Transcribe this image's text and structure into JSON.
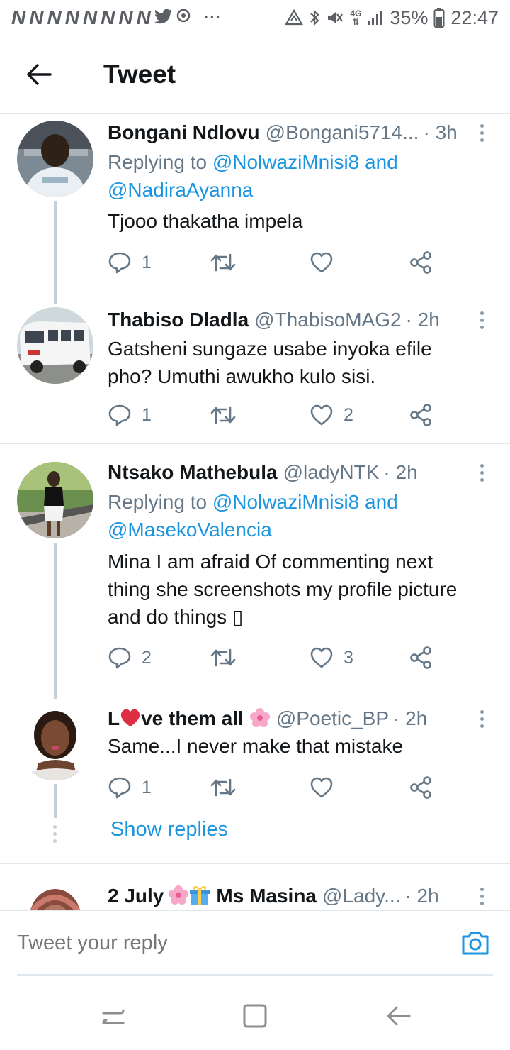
{
  "status_bar": {
    "notification_letters": [
      "N",
      "N",
      "N",
      "N",
      "N",
      "N",
      "N",
      "N"
    ],
    "ellipsis": "···",
    "network": "4G",
    "battery": "35%",
    "time": "22:47"
  },
  "header": {
    "title": "Tweet"
  },
  "tweets": [
    {
      "name": "Bongani Ndlovu",
      "handle": "@Bongani5714...",
      "time": "· 3h",
      "replying_prefix": "Replying to ",
      "replying_line1_mention": "@NolwaziMnisi8",
      "replying_and": " and",
      "replying_line2_mention": "@NadiraAyanna",
      "text": "Tjooo thakatha impela",
      "replies": "1",
      "retweets": "",
      "likes": ""
    },
    {
      "name": "Thabiso Dladla",
      "handle": "@ThabisoMAG2",
      "time": "· 2h",
      "text_line1": "Gatsheni sungaze usabe inyoka efile",
      "text_line2": "pho? Umuthi awukho kulo sisi.",
      "replies": "1",
      "retweets": "",
      "likes": "2"
    },
    {
      "name": "Ntsako Mathebula",
      "handle": "@ladyNTK",
      "time": "· 2h",
      "replying_prefix": "Replying to ",
      "replying_line1_mention": "@NolwaziMnisi8",
      "replying_and": " and",
      "replying_line2_mention": "@MasekoValencia",
      "text_line1": "Mina I am afraid Of commenting next",
      "text_line2": "thing she screenshots my profile picture",
      "text_line3": "and do things ▯",
      "replies": "2",
      "retweets": "",
      "likes": "3"
    },
    {
      "name_prefix": "L",
      "name_suffix": "ve them all",
      "handle": "@Poetic_BP",
      "time": "· 2h",
      "text": "Same...I never make that mistake",
      "replies": "1",
      "retweets": "",
      "likes": ""
    },
    {
      "name_prefix": "2 July",
      "name_suffix": "Ms Masina",
      "handle": "@Lady...",
      "time": "· 2h"
    }
  ],
  "show_replies": "Show replies",
  "composer": {
    "placeholder": "Tweet your reply"
  },
  "icons": {
    "back": "arrow-left-icon",
    "more": "more-vertical-icon",
    "reply": "reply-bubble-icon",
    "retweet": "retweet-icon",
    "like": "heart-icon",
    "share": "share-icon",
    "camera": "camera-icon"
  },
  "colors": {
    "accent": "#1b95e0",
    "text": "#14171a",
    "muted": "#657786",
    "heart": "#e0245e",
    "divider": "#e1e8ed"
  }
}
